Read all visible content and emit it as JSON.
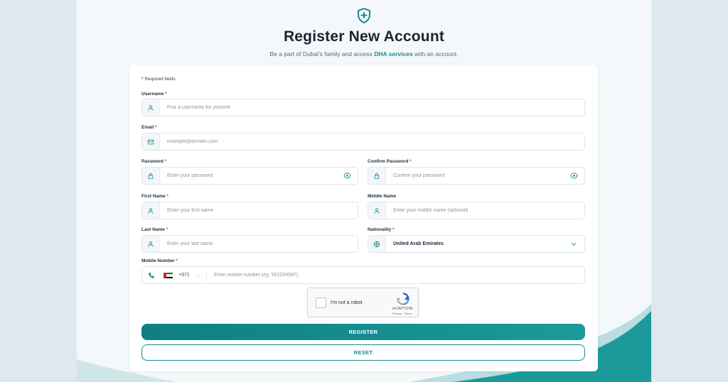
{
  "header": {
    "title": "Register New Account",
    "subtitle_before": "Be a part of Dubai's family and access ",
    "subtitle_link": "DHA services",
    "subtitle_after": " with an account."
  },
  "form": {
    "required_note_star": "*",
    "required_note": " Required fields",
    "username": {
      "label": "Username",
      "placeholder": "Pick a username for yourself"
    },
    "email": {
      "label": "Email",
      "placeholder": "example@domain.com"
    },
    "password": {
      "label": "Password",
      "placeholder": "Enter your password"
    },
    "confirm_password": {
      "label": "Confirm Password",
      "placeholder": "Confirm your password"
    },
    "first_name": {
      "label": "First Name",
      "placeholder": "Enter your first name"
    },
    "middle_name": {
      "label": "Middle Name",
      "placeholder": "Enter your middle name (optional)"
    },
    "last_name": {
      "label": "Last Name",
      "placeholder": "Enter your last name"
    },
    "nationality": {
      "label": "Nationality",
      "value": "United Arab Emirates"
    },
    "mobile": {
      "label": "Mobile Number",
      "country_code": "+971",
      "placeholder": "Enter mobile number (eg. 501234567)"
    },
    "required_marker": "*"
  },
  "captcha": {
    "label": "I'm not a robot",
    "brand": "reCAPTCHA",
    "terms": "Privacy - Terms"
  },
  "buttons": {
    "register": "REGISTER",
    "reset": "RESET"
  },
  "colors": {
    "accent": "#178a8e",
    "required": "#d23a3a"
  },
  "icons": {
    "logo": "shield-plus-icon",
    "user": "user-icon",
    "mail": "mail-icon",
    "lock": "lock-icon",
    "eye": "eye-icon",
    "globe": "globe-icon",
    "chevron": "chevron-down-icon",
    "phone": "phone-icon",
    "flag": "uae-flag-icon"
  }
}
